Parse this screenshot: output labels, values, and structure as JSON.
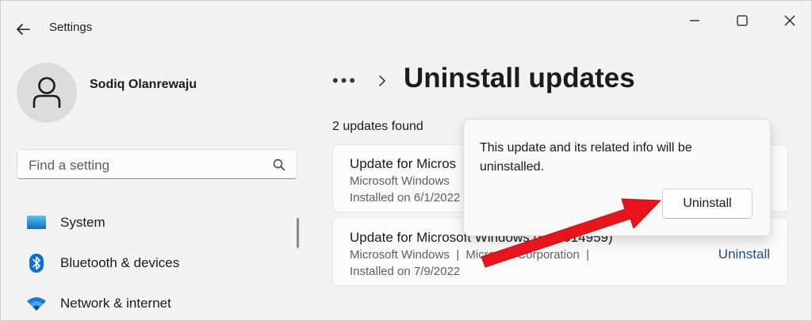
{
  "window": {
    "title": "Settings"
  },
  "user": {
    "name": "Sodiq Olanrewaju"
  },
  "search": {
    "placeholder": "Find a setting"
  },
  "nav": [
    {
      "label": "System",
      "icon": "monitor-icon"
    },
    {
      "label": "Bluetooth & devices",
      "icon": "bluetooth-icon"
    },
    {
      "label": "Network & internet",
      "icon": "wifi-icon"
    }
  ],
  "breadcrumb": {
    "more": "•••",
    "current": "Uninstall updates"
  },
  "updates": {
    "count_text": "2 updates found",
    "items": [
      {
        "title": "Update for Micros",
        "publisher": "Microsoft Windows",
        "installed": "Installed on 6/1/2022",
        "action": ""
      },
      {
        "title": "Update for Microsoft Windows (KB5014959)",
        "publisher": "Microsoft Windows  |  Microsoft Corporation  |",
        "installed": "Installed on 7/9/2022",
        "action": "Uninstall"
      }
    ]
  },
  "flyout": {
    "message": "This update and its related info will be uninstalled.",
    "button": "Uninstall"
  },
  "colors": {
    "accent": "#0067c0",
    "link": "#1f4f7a",
    "annotation_arrow": "#e8141c"
  }
}
